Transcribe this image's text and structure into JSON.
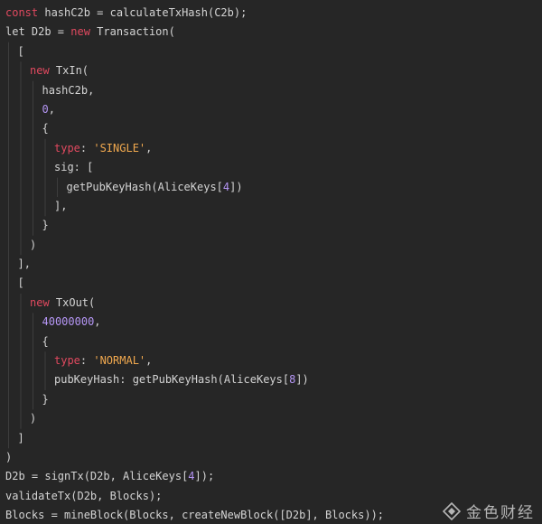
{
  "code": {
    "lines": [
      {
        "indent": 0,
        "tokens": [
          {
            "t": "kw",
            "v": "const"
          },
          {
            "t": "plain",
            "v": " hashC2b = calculateTxHash(C2b);"
          }
        ]
      },
      {
        "indent": 0,
        "tokens": [
          {
            "t": "plain",
            "v": "let D2b = "
          },
          {
            "t": "kw",
            "v": "new"
          },
          {
            "t": "plain",
            "v": " Transaction("
          }
        ]
      },
      {
        "indent": 1,
        "tokens": [
          {
            "t": "plain",
            "v": "["
          }
        ]
      },
      {
        "indent": 2,
        "tokens": [
          {
            "t": "kw",
            "v": "new"
          },
          {
            "t": "plain",
            "v": " TxIn("
          }
        ]
      },
      {
        "indent": 3,
        "tokens": [
          {
            "t": "plain",
            "v": "hashC2b,"
          }
        ]
      },
      {
        "indent": 3,
        "tokens": [
          {
            "t": "num",
            "v": "0"
          },
          {
            "t": "plain",
            "v": ","
          }
        ]
      },
      {
        "indent": 3,
        "tokens": [
          {
            "t": "plain",
            "v": "{"
          }
        ]
      },
      {
        "indent": 4,
        "tokens": [
          {
            "t": "kw",
            "v": "type"
          },
          {
            "t": "plain",
            "v": ": "
          },
          {
            "t": "str",
            "v": "'SINGLE'"
          },
          {
            "t": "plain",
            "v": ","
          }
        ]
      },
      {
        "indent": 4,
        "tokens": [
          {
            "t": "plain",
            "v": "sig: ["
          }
        ]
      },
      {
        "indent": 5,
        "tokens": [
          {
            "t": "plain",
            "v": "getPubKeyHash(AliceKeys["
          },
          {
            "t": "num",
            "v": "4"
          },
          {
            "t": "plain",
            "v": "])"
          }
        ]
      },
      {
        "indent": 4,
        "tokens": [
          {
            "t": "plain",
            "v": "],"
          }
        ]
      },
      {
        "indent": 3,
        "tokens": [
          {
            "t": "plain",
            "v": "}"
          }
        ]
      },
      {
        "indent": 2,
        "tokens": [
          {
            "t": "plain",
            "v": ")"
          }
        ]
      },
      {
        "indent": 1,
        "tokens": [
          {
            "t": "plain",
            "v": "],"
          }
        ]
      },
      {
        "indent": 1,
        "tokens": [
          {
            "t": "plain",
            "v": "["
          }
        ]
      },
      {
        "indent": 2,
        "tokens": [
          {
            "t": "kw",
            "v": "new"
          },
          {
            "t": "plain",
            "v": " TxOut("
          }
        ]
      },
      {
        "indent": 3,
        "tokens": [
          {
            "t": "num",
            "v": "40000000"
          },
          {
            "t": "plain",
            "v": ","
          }
        ]
      },
      {
        "indent": 3,
        "tokens": [
          {
            "t": "plain",
            "v": "{"
          }
        ]
      },
      {
        "indent": 4,
        "tokens": [
          {
            "t": "kw",
            "v": "type"
          },
          {
            "t": "plain",
            "v": ": "
          },
          {
            "t": "str",
            "v": "'NORMAL'"
          },
          {
            "t": "plain",
            "v": ","
          }
        ]
      },
      {
        "indent": 4,
        "tokens": [
          {
            "t": "plain",
            "v": "pubKeyHash: getPubKeyHash(AliceKeys["
          },
          {
            "t": "num",
            "v": "8"
          },
          {
            "t": "plain",
            "v": "])"
          }
        ]
      },
      {
        "indent": 3,
        "tokens": [
          {
            "t": "plain",
            "v": "}"
          }
        ]
      },
      {
        "indent": 2,
        "tokens": [
          {
            "t": "plain",
            "v": ")"
          }
        ]
      },
      {
        "indent": 1,
        "tokens": [
          {
            "t": "plain",
            "v": "]"
          }
        ]
      },
      {
        "indent": 0,
        "tokens": [
          {
            "t": "plain",
            "v": ")"
          }
        ]
      },
      {
        "indent": 0,
        "tokens": [
          {
            "t": "plain",
            "v": "D2b = signTx(D2b, AliceKeys["
          },
          {
            "t": "num",
            "v": "4"
          },
          {
            "t": "plain",
            "v": "]);"
          }
        ]
      },
      {
        "indent": 0,
        "tokens": [
          {
            "t": "plain",
            "v": "validateTx(D2b, Blocks);"
          }
        ]
      },
      {
        "indent": 0,
        "tokens": [
          {
            "t": "plain",
            "v": "Blocks = mineBlock(Blocks, createNewBlock([D2b], Blocks));"
          }
        ]
      }
    ]
  },
  "colors": {
    "background": "#262626",
    "keyword": "#e0495f",
    "string": "#f0a84e",
    "number": "#b596f5",
    "text": "#d4d4d4"
  },
  "watermark": {
    "text": "金色财经",
    "icon": "jinse-logo-icon"
  }
}
